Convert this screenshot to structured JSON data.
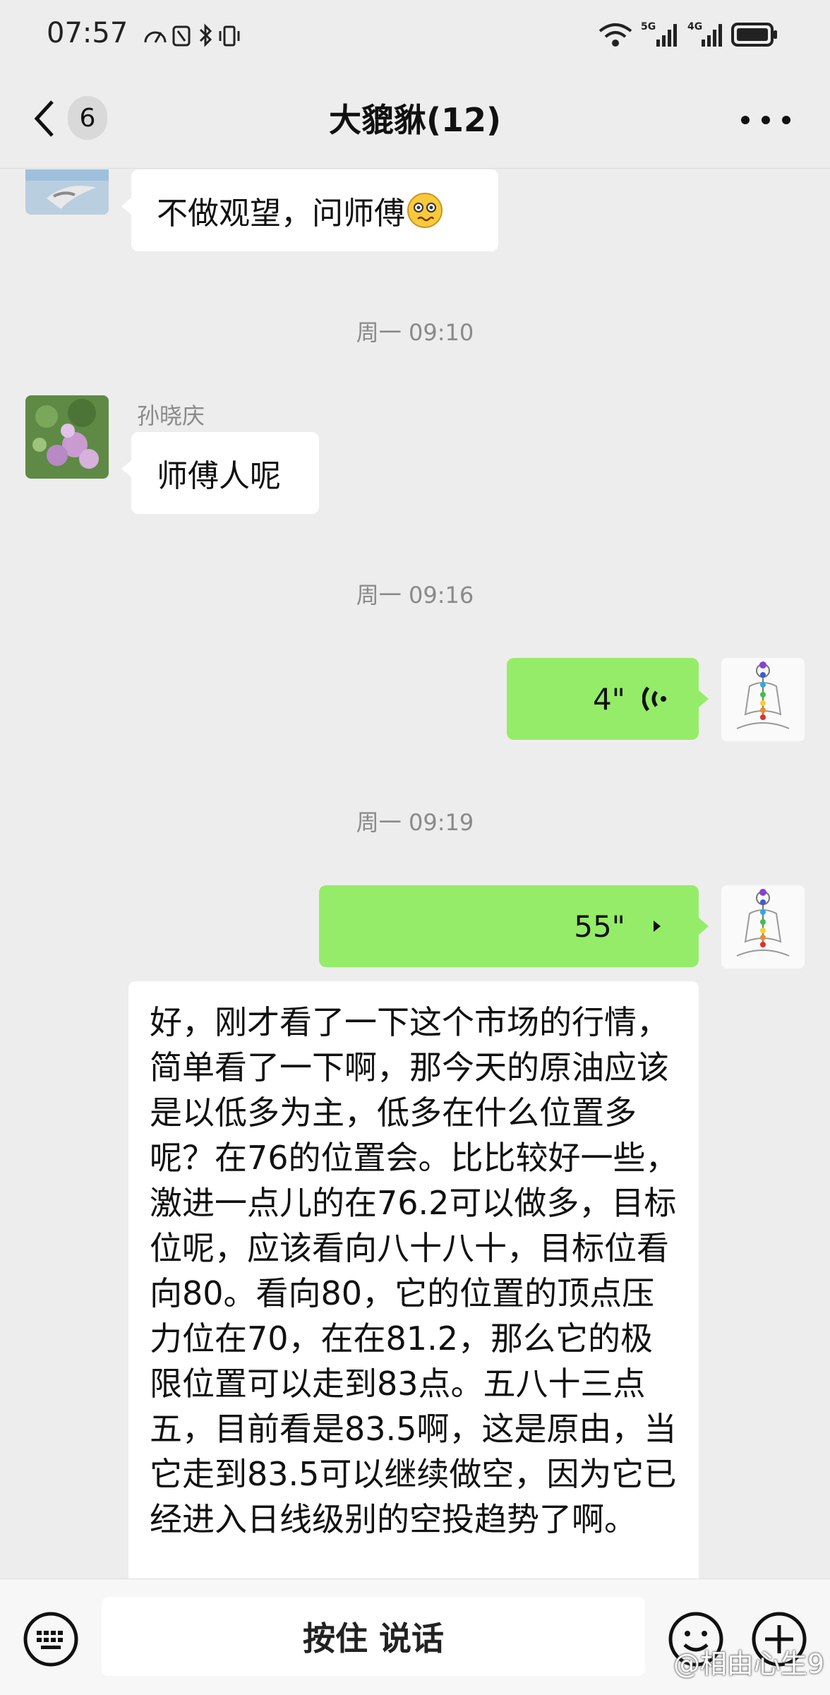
{
  "status_bar": {
    "time": "07:57",
    "network_5g": "5G",
    "network_4g": "4G"
  },
  "header": {
    "unread_count": "6",
    "title": "大貔貅(12)"
  },
  "messages": {
    "msg1_text": "不做观望，问师傅",
    "time1": "周一 09:10",
    "msg2_sender": "孙晓庆",
    "msg2_text": "师傅人呢",
    "time2": "周一 09:16",
    "voice1_duration": "4\"",
    "time3": "周一 09:19",
    "voice2_duration": "55\"",
    "transcript": "好，刚才看了一下这个市场的行情，简单看了一下啊，那今天的原油应该是以低多为主，低多在什么位置多呢？在76的位置会。比比较好一些，激进一点儿的在76.2可以做多，目标位呢，应该看向八十八十，目标位看向80。看向80，它的位置的顶点压力位在70，在在81.2，那么它的极限位置可以走到83点。五八十三点五，目前看是83.5啊，这是原由，当它走到83.5可以继续做空，因为它已经进入日线级别的空投趋势了啊。"
  },
  "input_bar": {
    "hold_to_talk": "按住 说话"
  },
  "watermark": "@相由心生9",
  "colors": {
    "background": "#ededed",
    "own_bubble": "#95ec69",
    "other_bubble": "#ffffff"
  }
}
